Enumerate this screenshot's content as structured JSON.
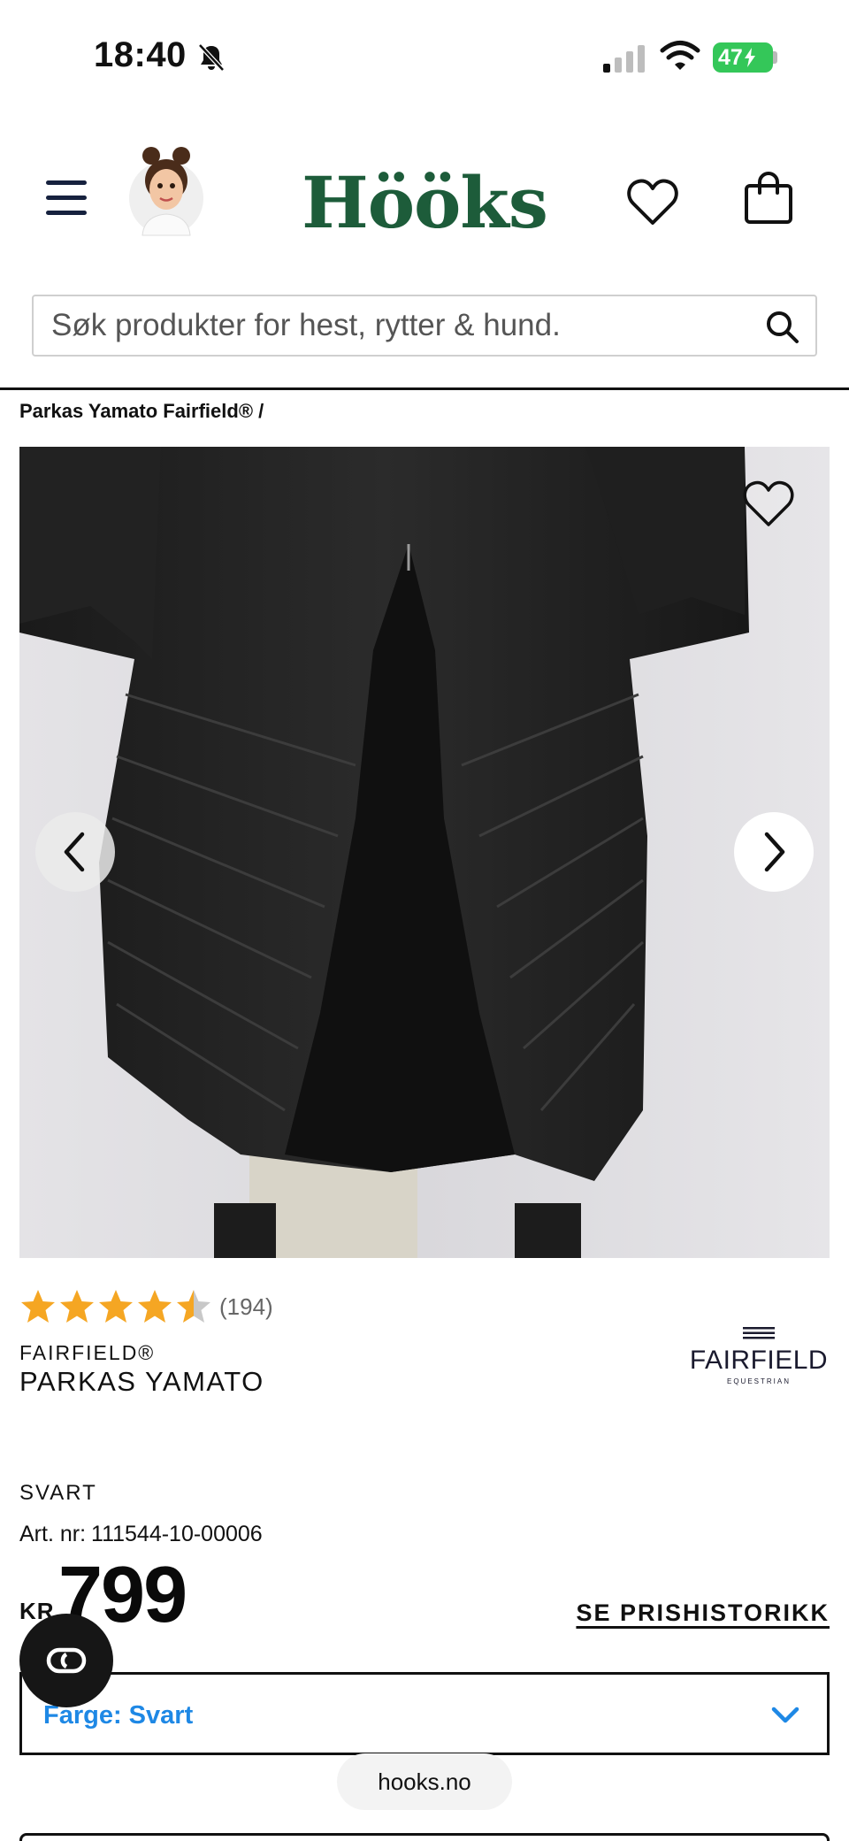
{
  "status_bar": {
    "time": "18:40",
    "battery": "47",
    "icons": [
      "bell-slash-icon",
      "signal-icon",
      "wifi-icon",
      "battery-icon"
    ]
  },
  "header": {
    "logo": "Hööks",
    "icons": [
      "menu-icon",
      "avatar",
      "heart-icon",
      "shopping-bag-icon"
    ]
  },
  "search": {
    "placeholder": "Søk produkter for hest, rytter & hund."
  },
  "breadcrumb": "Parkas Yamato Fairfield® /",
  "product": {
    "rating_count": "(194)",
    "rating_value": 4.5,
    "rating_max": 5,
    "brand": "FAIRFIELD®",
    "title": "PARKAS YAMATO",
    "brand_logo": {
      "name": "FAIRFIELD",
      "sub": "EQUESTRIAN"
    },
    "color": "SVART",
    "art_label": "Art. nr:",
    "art_number": "111544-10-00006",
    "price_currency": "KR",
    "price": "799",
    "price_history": "SE PRISHISTORIKK",
    "color_select": "Farge: Svart"
  },
  "browser": {
    "url": "hooks.no"
  },
  "colors": {
    "brand_green": "#1d5c3a",
    "accent_blue": "#1e88e5",
    "star_orange": "#f5a623",
    "battery_green": "#34c759"
  }
}
